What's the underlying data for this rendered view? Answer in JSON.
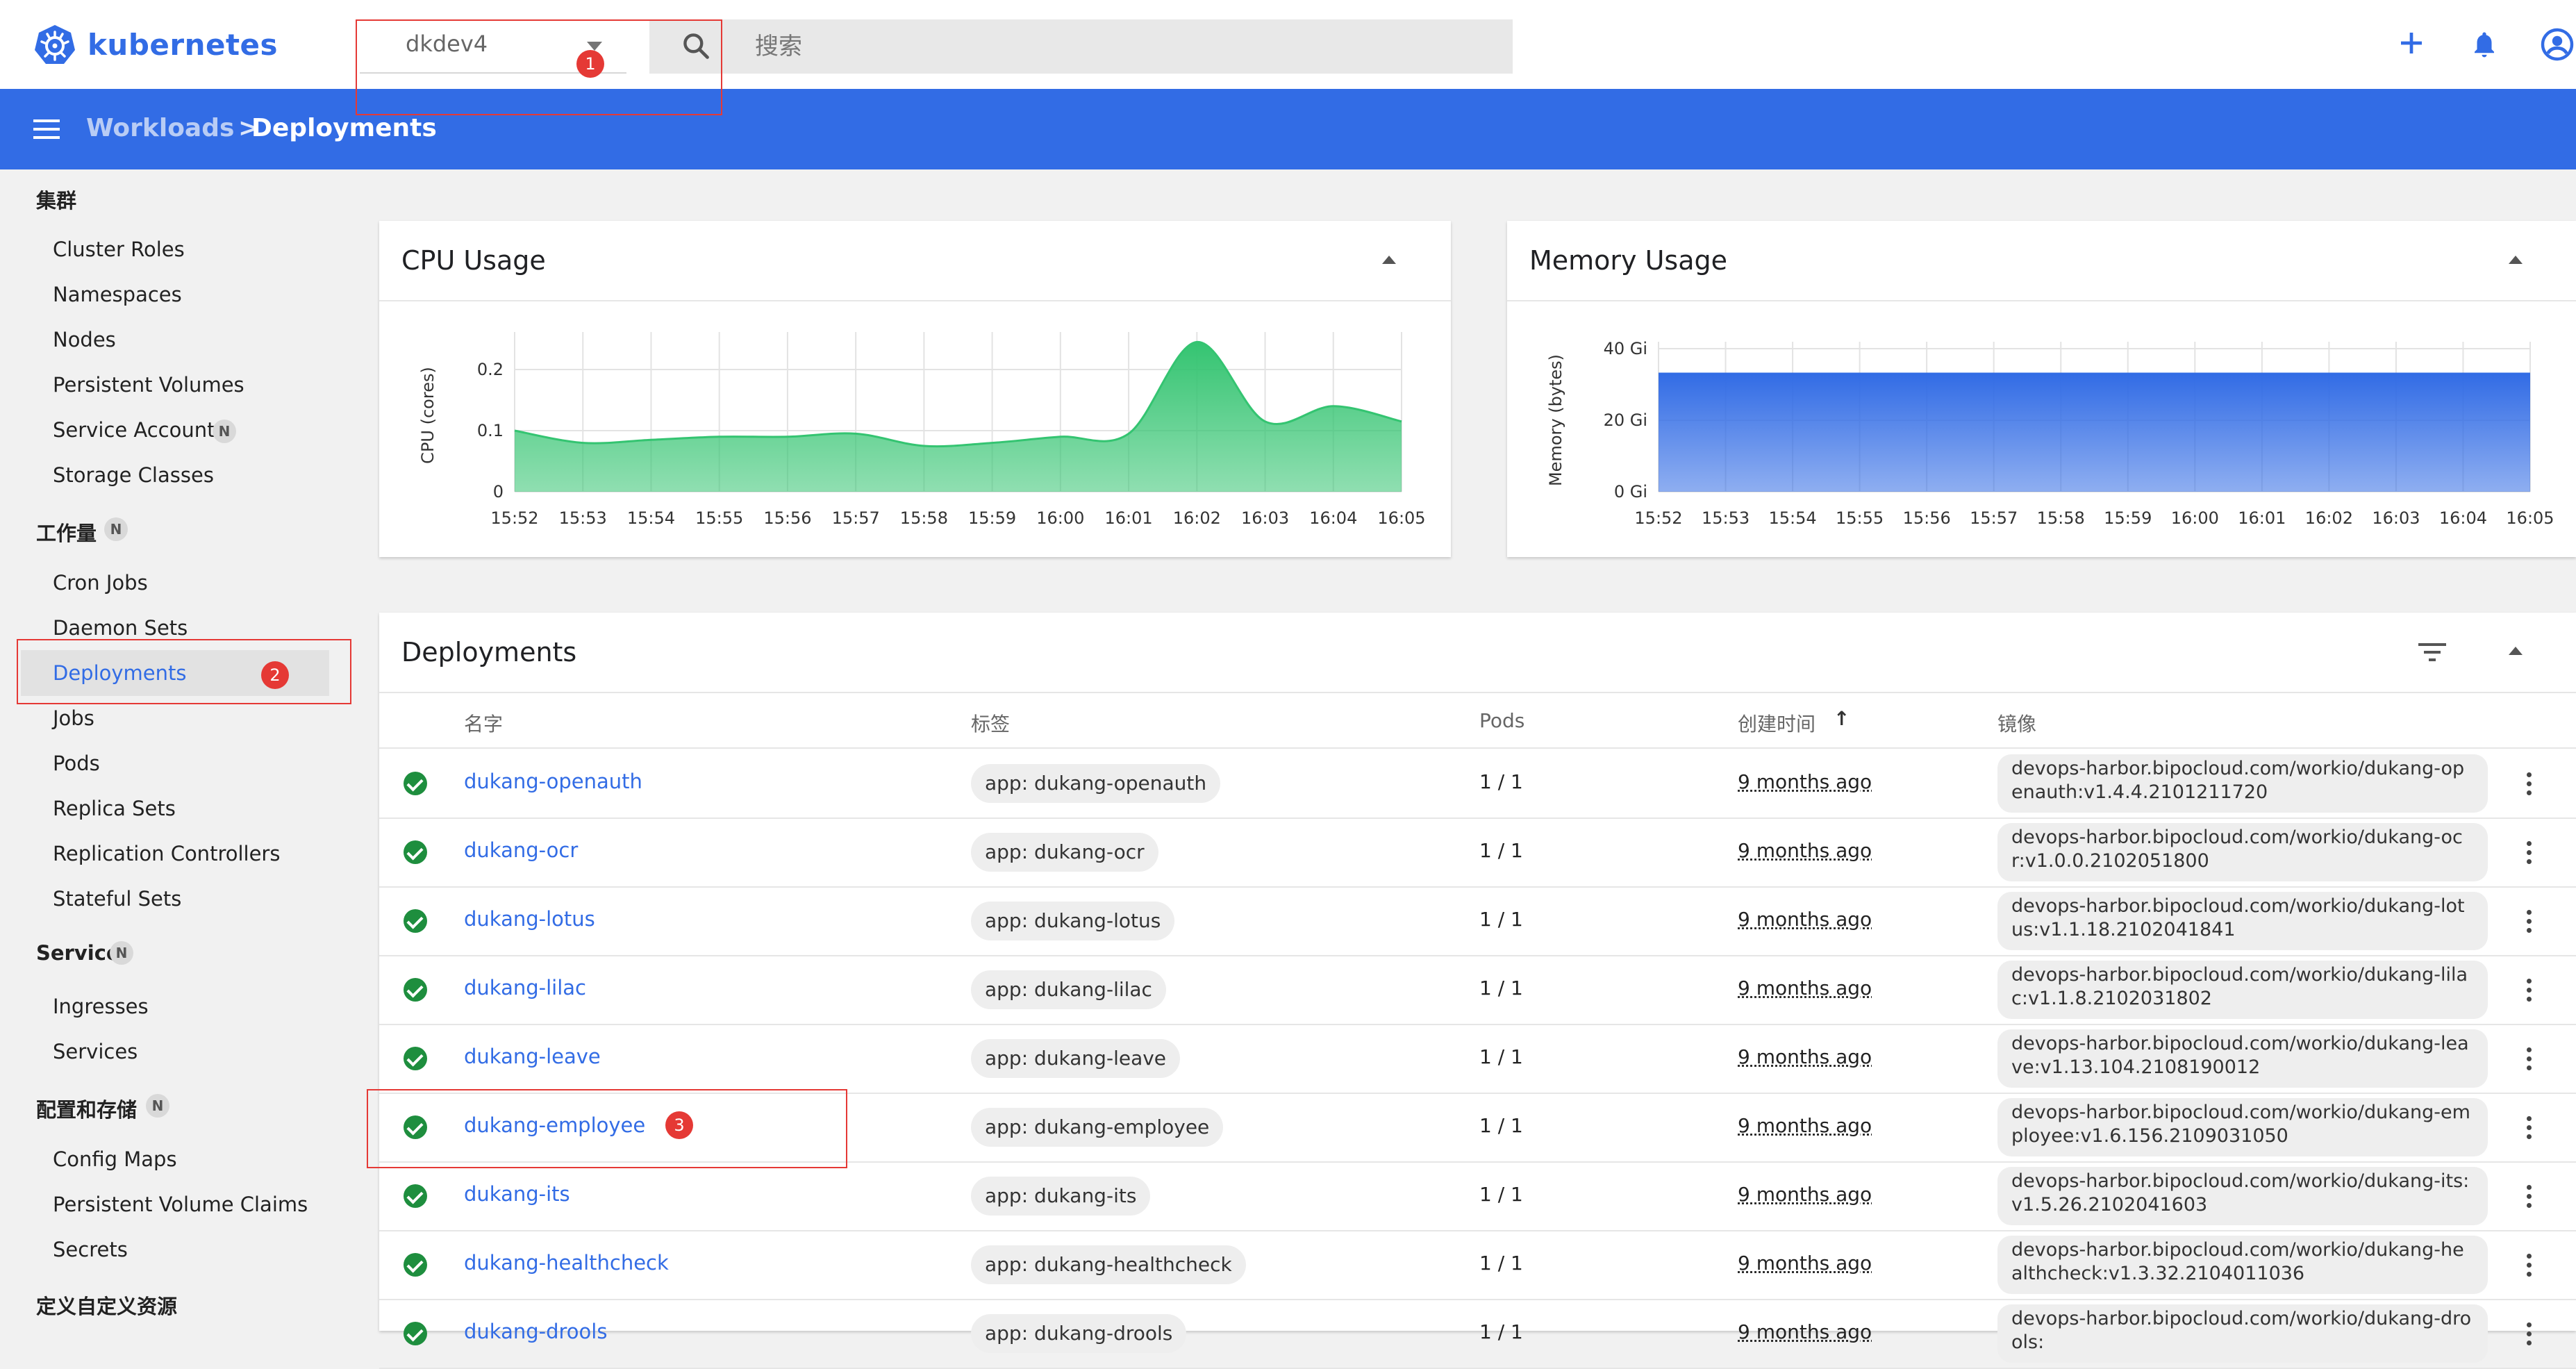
{
  "header": {
    "brand": "kubernetes",
    "namespace": "dkdev4",
    "search_placeholder": "搜索"
  },
  "breadcrumb": {
    "parent": "Workloads",
    "separator": ">",
    "current": "Deployments"
  },
  "sidebar": {
    "cluster": {
      "heading": "集群",
      "items": [
        "Cluster Roles",
        "Namespaces",
        "Nodes",
        "Persistent Volumes",
        "Service Accounts",
        "Storage Classes"
      ],
      "badge_item": "N"
    },
    "workloads": {
      "heading": "工作量",
      "badge": "N",
      "items": [
        "Cron Jobs",
        "Daemon Sets",
        "Deployments",
        "Jobs",
        "Pods",
        "Replica Sets",
        "Replication Controllers",
        "Stateful Sets"
      ]
    },
    "service": {
      "heading": "Service",
      "badge": "N",
      "items": [
        "Ingresses",
        "Services"
      ]
    },
    "config": {
      "heading": "配置和存储",
      "badge": "N",
      "items": [
        "Config Maps",
        "Persistent Volume Claims",
        "Secrets"
      ]
    },
    "crd": {
      "heading": "定义自定义资源"
    }
  },
  "cpu_card": {
    "title": "CPU Usage"
  },
  "memory_card": {
    "title": "Memory Usage"
  },
  "chart_data": [
    {
      "type": "area",
      "ylabel": "CPU (cores)",
      "x": [
        "15:52",
        "15:53",
        "15:54",
        "15:55",
        "15:56",
        "15:57",
        "15:58",
        "15:59",
        "16:00",
        "16:01",
        "16:02",
        "16:03",
        "16:04",
        "16:05"
      ],
      "yticks": [
        "0",
        "0.1",
        "0.2"
      ],
      "ylim": [
        0,
        0.25
      ],
      "series": [
        {
          "values": [
            0.1,
            0.08,
            0.085,
            0.09,
            0.09,
            0.095,
            0.075,
            0.08,
            0.09,
            0.095,
            0.245,
            0.115,
            0.14,
            0.115
          ]
        }
      ],
      "color": "#34c471"
    },
    {
      "type": "area",
      "ylabel": "Memory (bytes)",
      "x": [
        "15:52",
        "15:53",
        "15:54",
        "15:55",
        "15:56",
        "15:57",
        "15:58",
        "15:59",
        "16:00",
        "16:01",
        "16:02",
        "16:03",
        "16:04",
        "16:05"
      ],
      "yticks": [
        "0 Gi",
        "20 Gi",
        "40 Gi"
      ],
      "ylim": [
        0,
        40
      ],
      "series": [
        {
          "values": [
            33,
            33,
            33,
            33,
            33,
            33,
            33,
            33,
            33,
            33,
            33,
            33,
            33,
            33
          ]
        }
      ],
      "color": "#326ce5"
    }
  ],
  "deployments": {
    "title": "Deployments",
    "columns": {
      "name": "名字",
      "labels": "标签",
      "pods": "Pods",
      "created": "创建时间",
      "sort_arrow": "↑",
      "images": "镜像"
    },
    "rows": [
      {
        "name": "dukang-openauth",
        "label": "app: dukang-openauth",
        "pods": "1 / 1",
        "age": "9 months ago",
        "image": "devops-harbor.bipocloud.com/workio/dukang-openauth:v1.4.4.2101211720"
      },
      {
        "name": "dukang-ocr",
        "label": "app: dukang-ocr",
        "pods": "1 / 1",
        "age": "9 months ago",
        "image": "devops-harbor.bipocloud.com/workio/dukang-ocr:v1.0.0.2102051800"
      },
      {
        "name": "dukang-lotus",
        "label": "app: dukang-lotus",
        "pods": "1 / 1",
        "age": "9 months ago",
        "image": "devops-harbor.bipocloud.com/workio/dukang-lotus:v1.1.18.2102041841"
      },
      {
        "name": "dukang-lilac",
        "label": "app: dukang-lilac",
        "pods": "1 / 1",
        "age": "9 months ago",
        "image": "devops-harbor.bipocloud.com/workio/dukang-lilac:v1.1.8.2102031802"
      },
      {
        "name": "dukang-leave",
        "label": "app: dukang-leave",
        "pods": "1 / 1",
        "age": "9 months ago",
        "image": "devops-harbor.bipocloud.com/workio/dukang-leave:v1.13.104.2108190012"
      },
      {
        "name": "dukang-employee",
        "label": "app: dukang-employee",
        "pods": "1 / 1",
        "age": "9 months ago",
        "image": "devops-harbor.bipocloud.com/workio/dukang-employee:v1.6.156.2109031050"
      },
      {
        "name": "dukang-its",
        "label": "app: dukang-its",
        "pods": "1 / 1",
        "age": "9 months ago",
        "image": "devops-harbor.bipocloud.com/workio/dukang-its:v1.5.26.2102041603"
      },
      {
        "name": "dukang-healthcheck",
        "label": "app: dukang-healthcheck",
        "pods": "1 / 1",
        "age": "9 months ago",
        "image": "devops-harbor.bipocloud.com/workio/dukang-healthcheck:v1.3.32.2104011036"
      },
      {
        "name": "dukang-drools",
        "label": "app: dukang-drools",
        "pods": "1 / 1",
        "age": "9 months ago",
        "image": "devops-harbor.bipocloud.com/workio/dukang-drools:"
      }
    ]
  },
  "annotations": [
    "1",
    "2",
    "3"
  ],
  "colors": {
    "primary": "#326ce5",
    "ok": "#1e8e3e",
    "annotation": "#e53935"
  }
}
